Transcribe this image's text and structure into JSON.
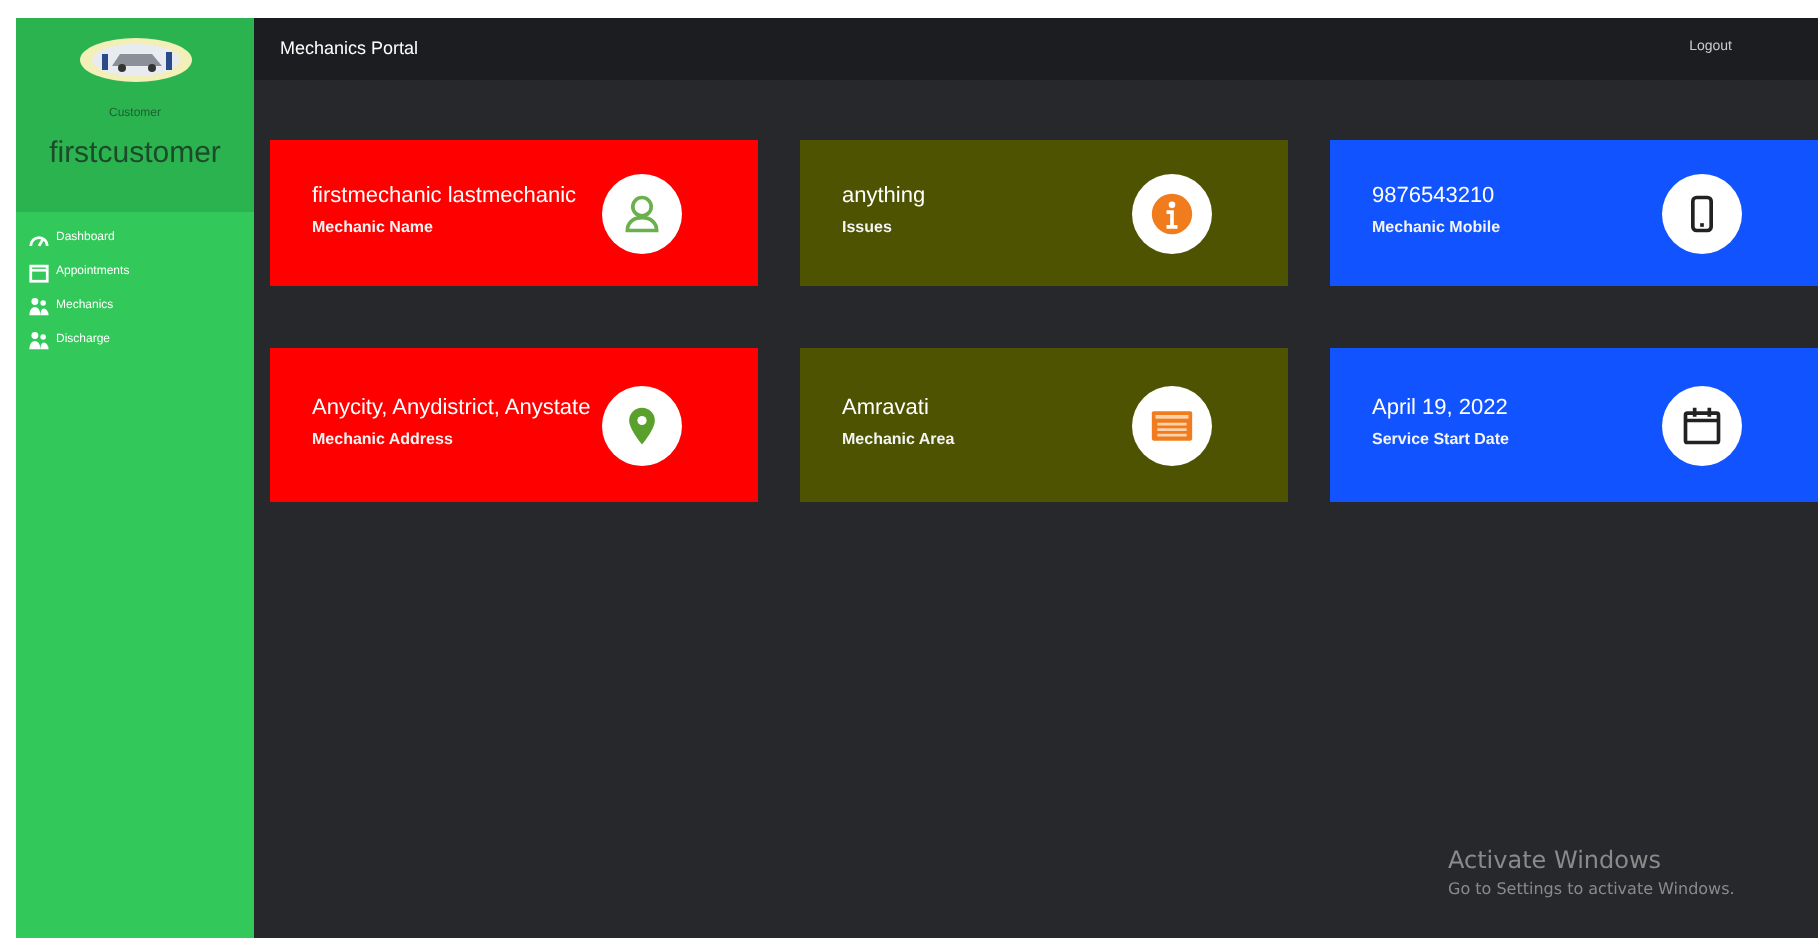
{
  "sidebar": {
    "role": "Customer",
    "username": "firstcustomer",
    "items": [
      {
        "label": "Dashboard",
        "kind": "gauge"
      },
      {
        "label": "Appointments",
        "kind": "calendar"
      },
      {
        "label": "Mechanics",
        "kind": "users"
      },
      {
        "label": "Discharge",
        "kind": "users"
      }
    ]
  },
  "header": {
    "title": "Mechanics Portal",
    "logout": "Logout"
  },
  "cards": [
    {
      "value": "firstmechanic lastmechanic",
      "label": "Mechanic Name",
      "color": "#ff0000",
      "kind": "person"
    },
    {
      "value": "anything",
      "label": "Issues",
      "color": "#4d5300",
      "kind": "info"
    },
    {
      "value": "9876543210",
      "label": "Mechanic Mobile",
      "color": "#1153ff",
      "kind": "phone"
    },
    {
      "value": "Anycity, Anydistrict, Anystate",
      "label": "Mechanic Address",
      "color": "#ff0000",
      "kind": "pin"
    },
    {
      "value": "Amravati",
      "label": "Mechanic Area",
      "color": "#4d5300",
      "kind": "list"
    },
    {
      "value": "April 19, 2022",
      "label": "Service Start Date",
      "color": "#1153ff",
      "kind": "calendar"
    }
  ],
  "notice": {
    "title": "Activate Windows",
    "text": "Go to Settings to activate Windows."
  }
}
